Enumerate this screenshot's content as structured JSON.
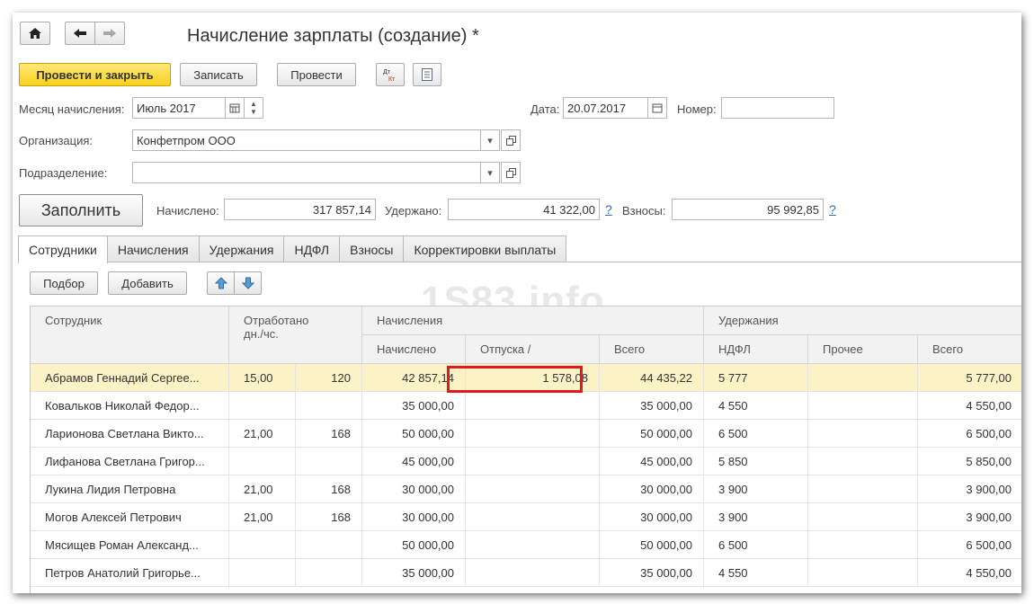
{
  "nav": {
    "home_icon": "home-icon",
    "back_icon": "arrow-left-icon",
    "forward_icon": "arrow-right-icon"
  },
  "window": {
    "title": "Начисление зарплаты (создание) *"
  },
  "toolbar": {
    "post_close": "Провести и закрыть",
    "save": "Записать",
    "post": "Провести",
    "dtkt_icon": "dt-kt-icon",
    "doc_icon": "document-icon"
  },
  "form": {
    "month_label": "Месяц начисления:",
    "month_value": "Июль 2017",
    "date_label": "Дата:",
    "date_value": "20.07.2017",
    "number_label": "Номер:",
    "number_value": "",
    "org_label": "Организация:",
    "org_value": "Конфетпром ООО",
    "dept_label": "Подразделение:",
    "dept_value": ""
  },
  "totals": {
    "fill_button": "Заполнить",
    "accrued_label": "Начислено:",
    "accrued_value": "317 857,14",
    "withheld_label": "Удержано:",
    "withheld_value": "41 322,00",
    "contrib_label": "Взносы:",
    "contrib_value": "95 992,85",
    "help": "?"
  },
  "tabs": [
    "Сотрудники",
    "Начисления",
    "Удержания",
    "НДФЛ",
    "Взносы",
    "Корректировки выплаты"
  ],
  "table_toolbar": {
    "select": "Подбор",
    "add": "Добавить"
  },
  "watermark": "1S83.info",
  "table": {
    "headers": {
      "employee": "Сотрудник",
      "worked": "Отработано\nдн./чс.",
      "accruals": "Начисления",
      "accrued": "Начислено",
      "vacation": "Отпуска /",
      "accruals_total": "Всего",
      "deductions": "Удержания",
      "ndfl": "НДФЛ",
      "other": "Прочее",
      "deductions_total": "Всего"
    },
    "rows": [
      {
        "name": "Абрамов Геннадий Сергее...",
        "days": "15,00",
        "hours": "120",
        "accrued": "42 857,14",
        "vacation": "1 578,08",
        "total": "44 435,22",
        "ndfl": "5 777",
        "other": "",
        "ded_total": "5 777,00"
      },
      {
        "name": "Ковальков Николай Федор...",
        "days": "",
        "hours": "",
        "accrued": "35 000,00",
        "vacation": "",
        "total": "35 000,00",
        "ndfl": "4 550",
        "other": "",
        "ded_total": "4 550,00"
      },
      {
        "name": "Ларионова Светлана Викто...",
        "days": "21,00",
        "hours": "168",
        "accrued": "50 000,00",
        "vacation": "",
        "total": "50 000,00",
        "ndfl": "6 500",
        "other": "",
        "ded_total": "6 500,00"
      },
      {
        "name": "Лифанова Светлана Григор...",
        "days": "",
        "hours": "",
        "accrued": "45 000,00",
        "vacation": "",
        "total": "45 000,00",
        "ndfl": "5 850",
        "other": "",
        "ded_total": "5 850,00"
      },
      {
        "name": "Лукина Лидия Петровна",
        "days": "21,00",
        "hours": "168",
        "accrued": "30 000,00",
        "vacation": "",
        "total": "30 000,00",
        "ndfl": "3 900",
        "other": "",
        "ded_total": "3 900,00"
      },
      {
        "name": "Могов Алексей Петрович",
        "days": "21,00",
        "hours": "168",
        "accrued": "30 000,00",
        "vacation": "",
        "total": "30 000,00",
        "ndfl": "3 900",
        "other": "",
        "ded_total": "3 900,00"
      },
      {
        "name": "Мясищев Роман Александ...",
        "days": "",
        "hours": "",
        "accrued": "50 000,00",
        "vacation": "",
        "total": "50 000,00",
        "ndfl": "6 500",
        "other": "",
        "ded_total": "6 500,00"
      },
      {
        "name": "Петров Анатолий Григорье...",
        "days": "",
        "hours": "",
        "accrued": "35 000,00",
        "vacation": "",
        "total": "35 000,00",
        "ndfl": "4 550",
        "other": "",
        "ded_total": "4 550,00"
      }
    ]
  },
  "colors": {
    "primary_button": "#f7d21c",
    "selected_row": "#fbf3c6",
    "highlight": "#e0191e",
    "link": "#2a6ebb"
  }
}
